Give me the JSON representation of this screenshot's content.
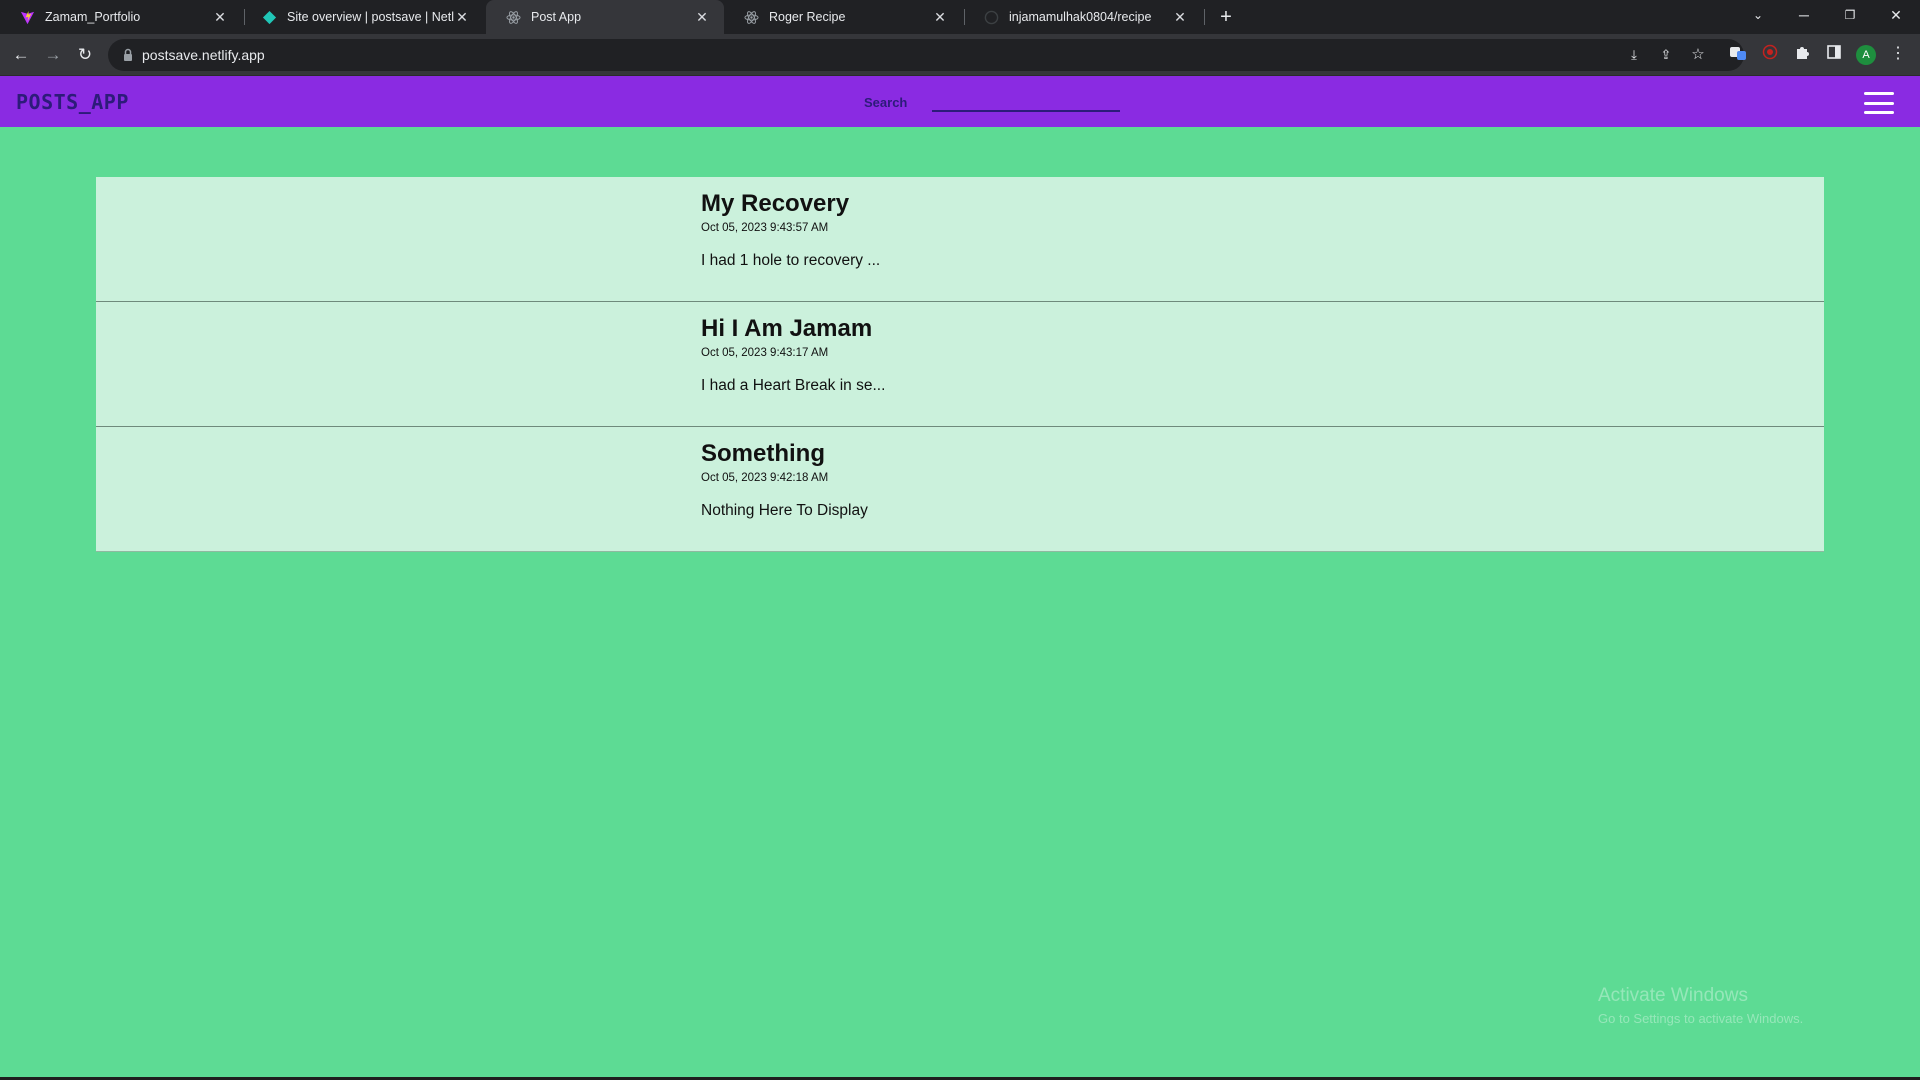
{
  "browser": {
    "tabs": [
      {
        "title": "Zamam_Portfolio",
        "favicon": "vite-icon",
        "active": false
      },
      {
        "title": "Site overview | postsave | Netlify",
        "favicon": "netlify-icon",
        "active": false
      },
      {
        "title": "Post App",
        "favicon": "react-icon",
        "active": true
      },
      {
        "title": "Roger Recipe",
        "favicon": "react-icon",
        "active": false
      },
      {
        "title": "injamamulhak0804/recipe",
        "favicon": "github-icon",
        "active": false
      }
    ],
    "url": "postsave.netlify.app",
    "profile_initial": "A"
  },
  "app": {
    "brand": "POSTS_APP",
    "search_label": "Search",
    "search_value": "",
    "colors": {
      "header_bg": "#8a2be2",
      "page_bg": "#5ddb94",
      "card_bg": "#cbf1dc",
      "brand_text": "#2d1b7a"
    }
  },
  "posts": [
    {
      "title": "My Recovery",
      "date": "Oct 05, 2023 9:43:57 AM",
      "excerpt": "I had 1 hole to recovery ..."
    },
    {
      "title": "Hi I Am Jamam",
      "date": "Oct 05, 2023 9:43:17 AM",
      "excerpt": "I had a Heart Break in se..."
    },
    {
      "title": "Something",
      "date": "Oct 05, 2023 9:42:18 AM",
      "excerpt": "Nothing Here To Display"
    }
  ],
  "watermark": {
    "line1": "Activate Windows",
    "line2": "Go to Settings to activate Windows."
  }
}
